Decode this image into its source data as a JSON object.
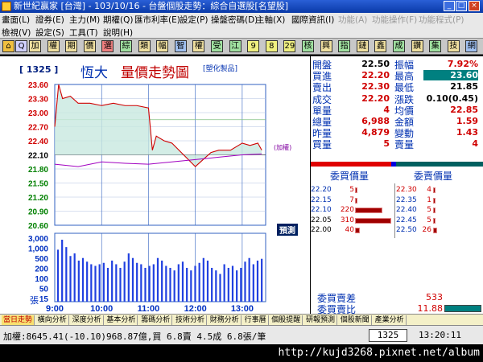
{
  "window": {
    "title": "新世紀贏家 [台灣] - 103/10/16 - 台盤個股走勢：綜合自選股[名望股]"
  },
  "menu": {
    "row1": [
      {
        "label": "畫面(L)",
        "dim": false
      },
      {
        "label": "證券(E)",
        "dim": false
      },
      {
        "label": "主力(M)",
        "dim": false
      },
      {
        "label": "期權(Q)",
        "dim": false
      },
      {
        "label": "匯市利率(E)",
        "dim": false
      },
      {
        "label": "設定(P)",
        "dim": false
      },
      {
        "label": "操盤密碼(D)",
        "dim": false
      },
      {
        "label": "主軸(X)",
        "dim": false
      },
      {
        "label": "國際資訊(I)",
        "dim": false
      },
      {
        "label": "功能(A)",
        "dim": true
      },
      {
        "label": "功能操作(F)",
        "dim": true
      },
      {
        "label": "功能程式(P)",
        "dim": true
      }
    ],
    "row2": [
      {
        "label": "檢視(V)",
        "dim": false
      },
      {
        "label": "設定(S)",
        "dim": false
      },
      {
        "label": "工具(T)",
        "dim": false
      },
      {
        "label": "說明(H)",
        "dim": false
      }
    ]
  },
  "toolbar": {
    "buttons": [
      "加",
      "權",
      "期",
      "價",
      "選",
      "綜",
      "類",
      "幅",
      "智",
      "權",
      "受",
      "江",
      "9",
      "8",
      "29",
      "核",
      "興",
      "指",
      "鏈",
      "鑫",
      "成",
      "鑽",
      "集",
      "技",
      "網"
    ]
  },
  "chart": {
    "code": "[ 1325 ]",
    "name": "恆大",
    "title": "量價走勢圖",
    "subtitle": "[塑化製品]",
    "forecast_label": "預測",
    "index_label": "(加權)",
    "volume_unit": "張"
  },
  "chart_data": {
    "type": "line",
    "title": "量價走勢圖",
    "price_axis": [
      23.6,
      23.3,
      23.0,
      22.7,
      22.4,
      22.1,
      21.8,
      21.5,
      21.2,
      20.9,
      20.6
    ],
    "reference_price": 22.1,
    "volume_axis": [
      "3,000",
      "1,000",
      "500",
      "200",
      "100",
      "50",
      "15"
    ],
    "x_ticks": [
      "9:00",
      "10:00",
      "11:00",
      "12:00",
      "13:00"
    ],
    "series": [
      {
        "name": "price",
        "x": [
          "9:00",
          "9:05",
          "9:10",
          "9:20",
          "9:30",
          "9:45",
          "10:00",
          "10:15",
          "10:30",
          "10:45",
          "11:00",
          "11:05",
          "11:10",
          "11:20",
          "11:30",
          "11:45",
          "12:00",
          "12:10",
          "12:20",
          "12:30",
          "12:45",
          "13:00",
          "13:10",
          "13:20",
          "13:25"
        ],
        "values": [
          22.7,
          23.6,
          23.3,
          23.35,
          23.2,
          23.2,
          23.15,
          23.2,
          23.15,
          23.15,
          23.1,
          22.2,
          22.5,
          22.4,
          22.35,
          22.1,
          21.85,
          22.0,
          22.15,
          22.2,
          22.2,
          22.35,
          22.3,
          22.35,
          22.2
        ]
      },
      {
        "name": "index",
        "x": [
          "9:00",
          "9:30",
          "10:00",
          "10:30",
          "11:00",
          "11:30",
          "12:00",
          "12:30",
          "13:00",
          "13:25"
        ],
        "values": [
          21.9,
          21.85,
          21.95,
          21.92,
          21.9,
          21.95,
          22.0,
          22.05,
          22.1,
          22.12
        ]
      }
    ],
    "volume": [
      300,
      900,
      400,
      150,
      200,
      90,
      120,
      80,
      60,
      50,
      60,
      70,
      40,
      90,
      60,
      40,
      80,
      200,
      120,
      70,
      60,
      40,
      50,
      60,
      120,
      90,
      50,
      40,
      30,
      60,
      80,
      40,
      30,
      50,
      70,
      120,
      90,
      40,
      30,
      20,
      60,
      40,
      50,
      30,
      40,
      80,
      120,
      60,
      90,
      110
    ]
  },
  "quote": {
    "rows": [
      {
        "l1": "開盤",
        "v1": "22.50",
        "l2": "振幅",
        "v2": "7.92%",
        "v2color": "#d00000"
      },
      {
        "l1": "買進",
        "v1": "22.20",
        "l2": "最高",
        "v2": "23.60",
        "v2color": "#ffffff",
        "v2bg": "#008080"
      },
      {
        "l1": "賣出",
        "v1": "22.30",
        "l2": "最低",
        "v2": "21.85",
        "v2color": "#000000"
      },
      {
        "l1": "成交",
        "v1": "22.20",
        "l2": "漲跌",
        "v2": "0.10(0.45)",
        "v2color": "#000000"
      },
      {
        "l1": "單量",
        "v1": "4",
        "l2": "均價",
        "v2": "22.85",
        "v2color": "#d00000"
      },
      {
        "l1": "總量",
        "v1": "6,988",
        "l2": "金額",
        "v2": "1.59",
        "v2color": "#d00000"
      },
      {
        "l1": "昨量",
        "v1": "4,879",
        "l2": "變動",
        "v2": "1.43",
        "v2color": "#d00000"
      },
      {
        "l1": "買量",
        "v1": "5",
        "l2": "賣量",
        "v2": "4",
        "v2color": "#d00000"
      }
    ],
    "book_header_buy": "委買價量",
    "book_header_sell": "委賣價量",
    "buy": [
      {
        "price": "22.20",
        "qty": "5",
        "level": 0.02
      },
      {
        "price": "22.15",
        "qty": "7",
        "level": 0.03
      },
      {
        "price": "22.10",
        "qty": "220",
        "level": 0.75
      },
      {
        "price": "22.05",
        "qty": "310",
        "level": 1.0
      },
      {
        "price": "22.00",
        "qty": "40",
        "level": 0.13
      }
    ],
    "sell": [
      {
        "price": "22.30",
        "qty": "4",
        "level": 0.02
      },
      {
        "price": "22.35",
        "qty": "1",
        "level": 0.01
      },
      {
        "price": "22.40",
        "qty": "5",
        "level": 0.02
      },
      {
        "price": "22.45",
        "qty": "5",
        "level": 0.02
      },
      {
        "price": "22.50",
        "qty": "26",
        "level": 0.12
      }
    ],
    "diff_label": "委買賣差",
    "diff_value": "533",
    "ratio_label": "委買賣比",
    "ratio_value": "11.88"
  },
  "tabs": [
    "當日走勢",
    "橫向分析",
    "深度分析",
    "基本分析",
    "籌碼分析",
    "技術分析",
    "財務分析",
    "行事曆",
    "個股提醒",
    "研報預測",
    "個股新聞",
    "產業分析"
  ],
  "status": {
    "text": "加權:8645.41(-10.10)968.87億,買 6.8賣 4.5成 6.8張/筆",
    "code": "1325",
    "time": "13:20:11"
  },
  "footer_url": "http://kujd3268.pixnet.net/album"
}
